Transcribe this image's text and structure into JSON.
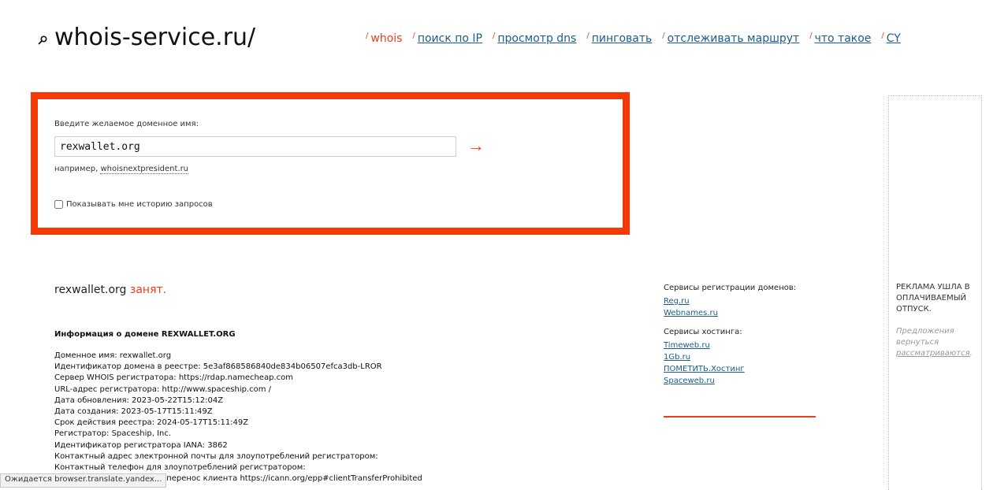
{
  "header": {
    "logo_icon": "search-icon",
    "logo_text": "whois-service.ru/"
  },
  "nav": [
    {
      "label": "whois",
      "active": true
    },
    {
      "label": "поиск по IP",
      "active": false
    },
    {
      "label": "просмотр dns",
      "active": false
    },
    {
      "label": "пинговать",
      "active": false
    },
    {
      "label": "отслеживать маршрут",
      "active": false
    },
    {
      "label": "что такое",
      "active": false
    },
    {
      "label": "CY",
      "active": false
    }
  ],
  "search": {
    "label": "Введите желаемое доменное имя:",
    "value": "rexwallet.org",
    "submit_glyph": "→",
    "example_prefix": "например,",
    "example_link": "whoisnextpresident.ru",
    "history_label": "Показывать мне историю запросов"
  },
  "result": {
    "domain": "rexwallet.org",
    "status": "занят."
  },
  "info": {
    "heading": "Информация о домене REXWALLET.ORG",
    "lines": [
      "Доменное имя: rexwallet.org",
      "Идентификатор домена в реестре: 5e3af868586840de834b06507efca3db-LROR",
      "Сервер WHOIS регистратора: https://rdap.namecheap.com",
      "URL-адрес регистратора: http://www.spaceship.com /",
      "Дата обновления: 2023-05-22T15:12:04Z",
      "Дата создания: 2023-05-17T15:11:49Z",
      "Срок действия реестра: 2024-05-17T15:11:49Z",
      "Регистратор: Spaceship, Inc.",
      "Идентификатор регистратора IANA: 3862",
      "Контактный адрес электронной почты для злоупотреблений регистратором:",
      "Контактный телефон для злоупотреблений регистратором:",
      "Статус домена: Запрещен перенос клиента https://icann.org/epp#clientTransferProhibited"
    ]
  },
  "services": {
    "registration_heading": "Сервисы регистрации доменов:",
    "registration": [
      "Reg.ru",
      "Webnames.ru"
    ],
    "hosting_heading": "Сервисы хостинга:",
    "hosting": [
      "Timeweb.ru",
      "1Gb.ru",
      "ПОМЕТИТЬ.Хостинг",
      "Spaceweb.ru"
    ]
  },
  "ad": {
    "title": "Реклама ушла в оплачиваемый отпуск.",
    "sub_prefix": "Предложения вернуться",
    "sub_link": "рассматриваются",
    "sub_suffix": "."
  },
  "statusbar": {
    "text": "Ожидается browser.translate.yandex..."
  },
  "colors": {
    "accent": "#e8401c",
    "box_border": "#f53a06",
    "link": "#1a5d8c"
  }
}
